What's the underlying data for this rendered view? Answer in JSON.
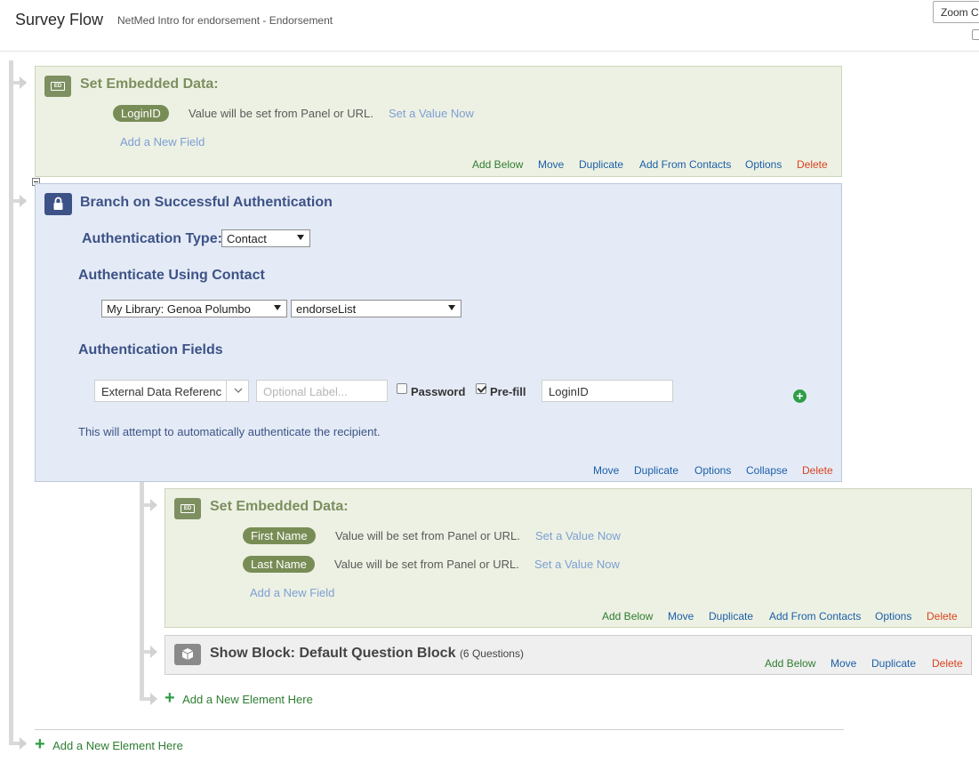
{
  "header": {
    "title": "Survey Flow",
    "subtitle": "NetMed Intro for endorsement - Endorsement",
    "zoom_label": "Zoom C"
  },
  "ed1": {
    "title": "Set Embedded Data:",
    "icon_text": "ED",
    "fields": [
      {
        "name": "LoginID",
        "value_text": "Value will be set from Panel or URL.",
        "link": "Set a Value Now"
      }
    ],
    "add_field": "Add a New Field",
    "actions": {
      "add_below": "Add Below",
      "move": "Move",
      "duplicate": "Duplicate",
      "add_from_contacts": "Add From Contacts",
      "options": "Options",
      "delete": "Delete"
    }
  },
  "auth": {
    "title": "Branch on Successful Authentication",
    "type_label": "Authentication Type:",
    "type_value": "Contact",
    "using_label": "Authenticate Using Contact",
    "library_value": "My Library: Genoa Polumbo",
    "list_value": "endorseList",
    "fields_label": "Authentication Fields",
    "field_select": "External Data Referenc",
    "label_placeholder": "Optional Label...",
    "password_label": "Password",
    "prefill_label": "Pre-fill",
    "prefill_value": "LoginID",
    "note": "This will attempt to automatically authenticate the recipient.",
    "actions": {
      "move": "Move",
      "duplicate": "Duplicate",
      "options": "Options",
      "collapse": "Collapse",
      "delete": "Delete"
    }
  },
  "ed2": {
    "title": "Set Embedded Data:",
    "icon_text": "ED",
    "fields": [
      {
        "name": "First Name",
        "value_text": "Value will be set from Panel or URL.",
        "link": "Set a Value Now"
      },
      {
        "name": "Last Name",
        "value_text": "Value will be set from Panel or URL.",
        "link": "Set a Value Now"
      }
    ],
    "add_field": "Add a New Field",
    "actions": {
      "add_below": "Add Below",
      "move": "Move",
      "duplicate": "Duplicate",
      "add_from_contacts": "Add From Contacts",
      "options": "Options",
      "delete": "Delete"
    }
  },
  "block": {
    "title": "Show Block: Default Question Block",
    "count": "(6 Questions)",
    "actions": {
      "add_below": "Add Below",
      "move": "Move",
      "duplicate": "Duplicate",
      "delete": "Delete"
    }
  },
  "add_inner": "Add a New Element Here",
  "add_outer": "Add a New Element Here",
  "colors": {
    "embedded_bg": "#edf1e3",
    "auth_bg": "#e4ebf6",
    "block_bg": "#efefef",
    "add_green": "#2e9e48",
    "delete_red": "#d9421f",
    "link_blue": "#1b5fa8"
  }
}
